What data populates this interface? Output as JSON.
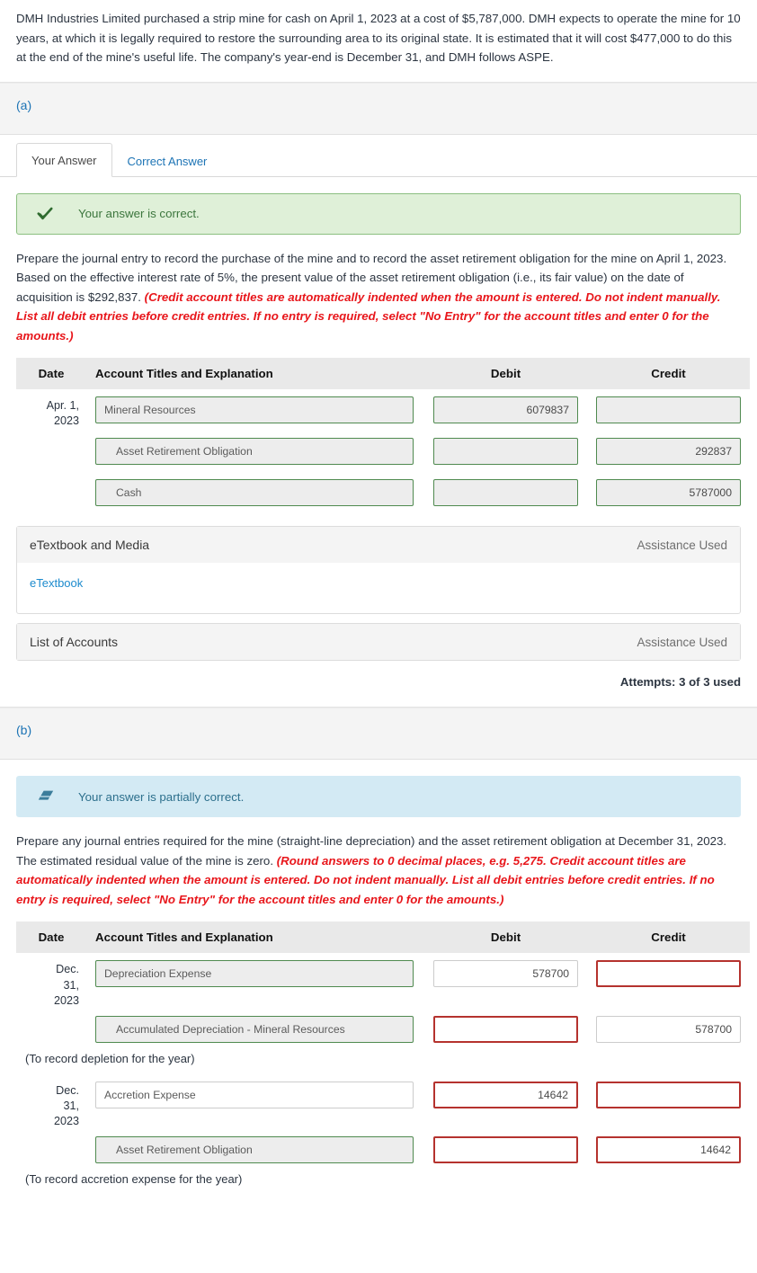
{
  "problem": {
    "text": "DMH Industries Limited purchased a strip mine for cash on April 1, 2023 at a cost of $5,787,000. DMH expects to operate the mine for 10 years, at which it is legally required to restore the surrounding area to its original state. It is estimated that it will cost $477,000 to do this at the end of the mine's useful life. The company's year-end is December 31, and DMH follows ASPE."
  },
  "parts": [
    {
      "label": "(a)",
      "tabs": [
        {
          "label": "Your Answer",
          "active": true
        },
        {
          "label": "Correct Answer",
          "active": false
        }
      ],
      "status": {
        "icon": "check-icon",
        "text": "Your answer is correct.",
        "kind": "correct"
      },
      "instructions": {
        "normal": "Prepare the journal entry to record the purchase of the mine and to record the asset retirement obligation for the mine on April 1, 2023. Based on the effective interest rate of 5%, the present value of the asset retirement obligation (i.e., its fair value) on the date of acquisition is $292,837. ",
        "hint": "(Credit account titles are automatically indented when the amount is entered. Do not indent manually. List all debit entries before credit entries. If no entry is required, select \"No Entry\" for the account titles and enter 0 for the amounts.)"
      },
      "table": {
        "headers": {
          "date": "Date",
          "account": "Account Titles and Explanation",
          "debit": "Debit",
          "credit": "Credit"
        },
        "rows": [
          {
            "date": "Apr. 1,\n2023",
            "account": "Mineral Resources",
            "account_state": "st-greenfill",
            "account_indent": false,
            "debit": "6079837",
            "debit_state": "st-greenfill",
            "credit": "",
            "credit_state": "st-greenfill"
          },
          {
            "date": "",
            "account": "Asset Retirement Obligation",
            "account_state": "st-greenfill",
            "account_indent": true,
            "debit": "",
            "debit_state": "st-greenfill",
            "credit": "292837",
            "credit_state": "st-greenfill"
          },
          {
            "date": "",
            "account": "Cash",
            "account_state": "st-greenfill",
            "account_indent": true,
            "debit": "",
            "debit_state": "st-greenfill",
            "credit": "5787000",
            "credit_state": "st-greenfill"
          }
        ],
        "memos": []
      },
      "panels": [
        {
          "title": "eTextbook and Media",
          "used": "Assistance Used",
          "link": "eTextbook",
          "has_body": true
        },
        {
          "title": "List of Accounts",
          "used": "Assistance Used",
          "link": "",
          "has_body": false
        }
      ],
      "attempts": "Attempts: 3 of 3 used"
    },
    {
      "label": "(b)",
      "tabs": [],
      "status": {
        "icon": "eraser-icon",
        "text": "Your answer is partially correct.",
        "kind": "partial"
      },
      "instructions": {
        "normal": "Prepare any journal entries required for the mine (straight-line depreciation) and the asset retirement obligation at December 31, 2023. The estimated residual value of the mine is zero. ",
        "hint": "(Round answers to 0 decimal places, e.g. 5,275. Credit account titles are automatically indented when the amount is entered. Do not indent manually. List all debit entries before credit entries. If no entry is required, select \"No Entry\" for the account titles and enter 0 for the amounts.)"
      },
      "table": {
        "headers": {
          "date": "Date",
          "account": "Account Titles and Explanation",
          "debit": "Debit",
          "credit": "Credit"
        },
        "rows": [
          {
            "date": "Dec.\n31,\n2023",
            "account": "Depreciation Expense",
            "account_state": "st-greenfill",
            "account_indent": false,
            "debit": "578700",
            "debit_state": "st-greywhite",
            "credit": "",
            "credit_state": "st-redwhite"
          },
          {
            "date": "",
            "account": "Accumulated Depreciation - Mineral Resources",
            "account_state": "st-greenfill",
            "account_indent": true,
            "debit": "",
            "debit_state": "st-redwhite",
            "credit": "578700",
            "credit_state": "st-greywhite"
          },
          {
            "memo": "(To record depletion for the year)"
          },
          {
            "date": "Dec.\n31,\n2023",
            "account": "Accretion Expense",
            "account_state": "st-greywhite",
            "account_indent": false,
            "debit": "14642",
            "debit_state": "st-redwhite",
            "credit": "",
            "credit_state": "st-redwhite"
          },
          {
            "date": "",
            "account": "Asset Retirement Obligation",
            "account_state": "st-greenfill",
            "account_indent": true,
            "debit": "",
            "debit_state": "st-redwhite",
            "credit": "14642",
            "credit_state": "st-redwhite"
          },
          {
            "memo": "(To record accretion expense for the year)"
          }
        ]
      },
      "panels": [],
      "attempts": ""
    }
  ],
  "colors": {
    "link": "#1d74b5",
    "hint_red": "#e8161b",
    "correct_green": "#3c763d",
    "partial_blue": "#2c6f8c",
    "field_green": "#4f8a4f",
    "field_red": "#b5322e"
  }
}
